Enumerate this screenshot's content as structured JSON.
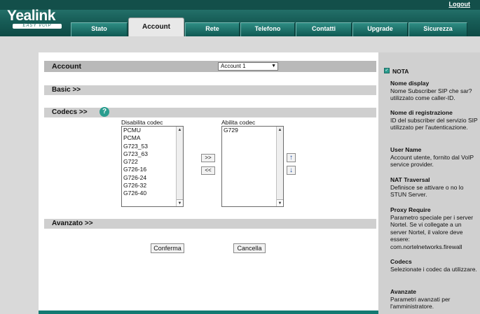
{
  "header": {
    "logo": "Yealink",
    "logo_tagline": "EASY VOIP",
    "logout": "Logout",
    "tabs": [
      "Stato",
      "Account",
      "Rete",
      "Telefono",
      "Contatti",
      "Upgrade",
      "Sicurezza"
    ],
    "active_tab": "Account"
  },
  "account": {
    "section_title": "Account",
    "selected": "Account 1"
  },
  "basic": {
    "title": "Basic >>"
  },
  "codecs": {
    "title": "Codecs >>",
    "disabled_label": "Disabilita codec",
    "enabled_label": "Abilita codec",
    "disabled": [
      "PCMU",
      "PCMA",
      "G723_53",
      "G723_63",
      "G722",
      "G726-16",
      "G726-24",
      "G726-32",
      "G726-40"
    ],
    "enabled": [
      "G729"
    ],
    "move_right": ">>",
    "move_left": "<<",
    "move_up": "↑",
    "move_down": "↓"
  },
  "advanced": {
    "title": "Avanzato >>"
  },
  "buttons": {
    "confirm": "Conferma",
    "cancel": "Cancella"
  },
  "sidebar": {
    "title": "NOTA",
    "notes": [
      {
        "title": "Nome display",
        "text": "Nome Subscriber SIP che sar? utilizzato come caller-ID."
      },
      {
        "title": "Nome di registrazione",
        "text": "ID del subscriber del servizio SIP utilizzato per l'autenticazione."
      },
      {
        "title": "User Name",
        "text": "Account utente, fornito dal VoIP service provider."
      },
      {
        "title": "NAT Traversal",
        "text": "Definisce se attivare o no lo STUN Server."
      },
      {
        "title": "Proxy Require",
        "text": "Parametro speciale per i server Nortel. Se vi collegate a un server Nortel, il valore deve essere: com.nortelnetworks.firewall"
      },
      {
        "title": "Codecs",
        "text": "Selezionate i codec da utilizzare."
      },
      {
        "title": "Avanzate",
        "text": "Parametri avanzati per l'amministratore."
      }
    ]
  },
  "colors": {
    "header": "#185e58",
    "accent": "#2a9d8f",
    "footer_bar": "#137a72"
  }
}
